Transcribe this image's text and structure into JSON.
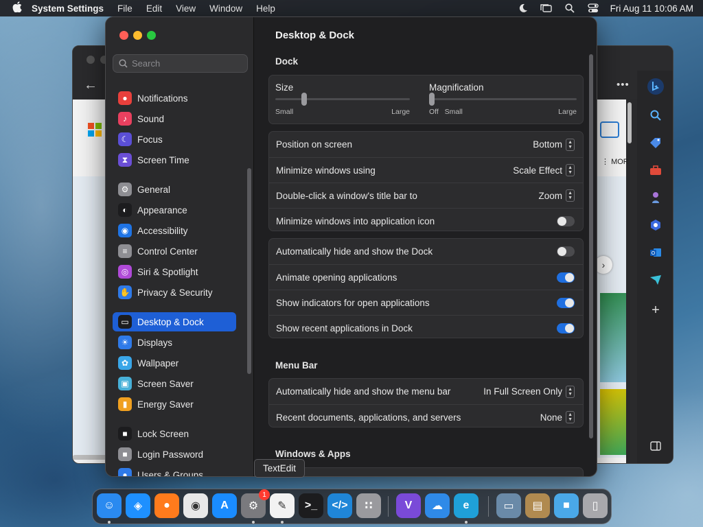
{
  "menubar": {
    "app_name": "System Settings",
    "items": [
      "File",
      "Edit",
      "View",
      "Window",
      "Help"
    ],
    "clock": "Fri Aug 11  10:06 AM"
  },
  "background_window": {
    "more_label": "MOR"
  },
  "sidebar": {
    "search_placeholder": "Search",
    "items": [
      {
        "label": "Notifications",
        "icon": "bell-icon",
        "color": "#e9403c"
      },
      {
        "label": "Sound",
        "icon": "speaker-icon",
        "color": "#e9405f"
      },
      {
        "label": "Focus",
        "icon": "moon-icon",
        "color": "#5b4fd6"
      },
      {
        "label": "Screen Time",
        "icon": "hourglass-icon",
        "color": "#6b4fd6"
      },
      {
        "label": "General",
        "icon": "gear-icon",
        "color": "#8e8e93"
      },
      {
        "label": "Appearance",
        "icon": "appearance-icon",
        "color": "#1c1c1e"
      },
      {
        "label": "Accessibility",
        "icon": "accessibility-icon",
        "color": "#1f74e5"
      },
      {
        "label": "Control Center",
        "icon": "control-center-icon",
        "color": "#8e8e93"
      },
      {
        "label": "Siri & Spotlight",
        "icon": "siri-icon",
        "color": "#b04ad8"
      },
      {
        "label": "Privacy & Security",
        "icon": "hand-icon",
        "color": "#2f7ae8"
      },
      {
        "label": "Desktop & Dock",
        "icon": "dock-icon",
        "color": "#1c1c1e"
      },
      {
        "label": "Displays",
        "icon": "sun-icon",
        "color": "#2f7ae8"
      },
      {
        "label": "Wallpaper",
        "icon": "flower-icon",
        "color": "#3aa6e8"
      },
      {
        "label": "Screen Saver",
        "icon": "screensaver-icon",
        "color": "#48b0d8"
      },
      {
        "label": "Energy Saver",
        "icon": "battery-icon",
        "color": "#f0a020"
      },
      {
        "label": "Lock Screen",
        "icon": "lock-icon",
        "color": "#1c1c1e"
      },
      {
        "label": "Login Password",
        "icon": "padlock-icon",
        "color": "#8e8e93"
      },
      {
        "label": "Users & Groups",
        "icon": "users-icon",
        "color": "#2f7ae8"
      }
    ],
    "selected_index": 10
  },
  "main": {
    "title": "Desktop & Dock",
    "dock_section": "Dock",
    "size": {
      "label": "Size",
      "min_label": "Small",
      "max_label": "Large",
      "value": 0.2
    },
    "magnification": {
      "label": "Magnification",
      "min_label": "Off",
      "mid_label": "Small",
      "max_label": "Large",
      "value": 0.0
    },
    "group1": [
      {
        "label": "Position on screen",
        "value": "Bottom"
      },
      {
        "label": "Minimize windows using",
        "value": "Scale Effect"
      },
      {
        "label": "Double-click a window's title bar to",
        "value": "Zoom"
      },
      {
        "label": "Minimize windows into application icon",
        "toggle": false
      }
    ],
    "group2": [
      {
        "label": "Automatically hide and show the Dock",
        "toggle": false
      },
      {
        "label": "Animate opening applications",
        "toggle": true
      },
      {
        "label": "Show indicators for open applications",
        "toggle": true
      },
      {
        "label": "Show recent applications in Dock",
        "toggle": true
      }
    ],
    "menubar_section": "Menu Bar",
    "group3": [
      {
        "label": "Automatically hide and show the menu bar",
        "value": "In Full Screen Only"
      },
      {
        "label": "Recent documents, applications, and servers",
        "value": "None"
      }
    ],
    "windows_section": "Windows & Apps"
  },
  "tooltip": "TextEdit",
  "dock": {
    "badge_count": "1",
    "apps": [
      {
        "name": "finder-icon",
        "color": "#2a8af0"
      },
      {
        "name": "safari-icon",
        "color": "#1e90ff"
      },
      {
        "name": "firefox-icon",
        "color": "#ff7b1c"
      },
      {
        "name": "chrome-icon",
        "color": "#e8e8e8"
      },
      {
        "name": "app-store-icon",
        "color": "#1a8cff"
      },
      {
        "name": "system-settings-icon",
        "color": "#7a7a7e"
      },
      {
        "name": "textedit-icon",
        "color": "#f2f2f2"
      },
      {
        "name": "terminal-icon",
        "color": "#1c1c1e"
      },
      {
        "name": "vscode-icon",
        "color": "#1f86d8"
      },
      {
        "name": "launchpad-icon",
        "color": "#9a9a9e"
      },
      {
        "name": "visual-studio-icon",
        "color": "#7a4ad8"
      },
      {
        "name": "weather-icon",
        "color": "#2f8ae8"
      },
      {
        "name": "edge-icon",
        "color": "#1fa0d8"
      },
      {
        "name": "preview-icon",
        "color": "#6a8aa8"
      },
      {
        "name": "archive-icon",
        "color": "#b08a50"
      },
      {
        "name": "folder-icon",
        "color": "#4aa8e8"
      },
      {
        "name": "trash-icon",
        "color": "#a8a8ac"
      }
    ]
  }
}
